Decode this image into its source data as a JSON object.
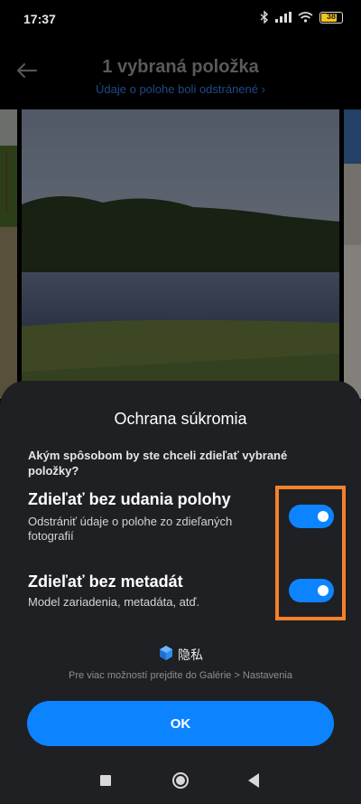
{
  "status": {
    "time": "17:37",
    "battery": "38",
    "icons": [
      "bluetooth-icon",
      "signal-icon",
      "wifi-icon",
      "battery-icon"
    ]
  },
  "header": {
    "title": "1 vybraná položka",
    "subtitle": "Údaje o polohe boli odstránené ›",
    "back_icon": "arrow-left-icon"
  },
  "sheet": {
    "title": "Ochrana súkromia",
    "question": "Akým spôsobom by ste chceli zdieľať vybrané položky?",
    "options": [
      {
        "title": "Zdieľať bez udania polohy",
        "desc": "Odstrániť údaje o polohe zo zdieľaných fotografií",
        "enabled": true
      },
      {
        "title": "Zdieľať bez metadát",
        "desc": "Model zariadenia, metadáta, atď.",
        "enabled": true
      }
    ],
    "brand_label": "隐私",
    "hint": "Pre viac možností prejdite do Galérie > Nastavenia",
    "ok_label": "OK"
  },
  "colors": {
    "accent": "#0d84ff",
    "highlight": "#f5812a",
    "sheet_bg": "#1f2023"
  },
  "navbar": {
    "icons": [
      "recents-square-icon",
      "home-circle-icon",
      "back-triangle-icon"
    ]
  }
}
